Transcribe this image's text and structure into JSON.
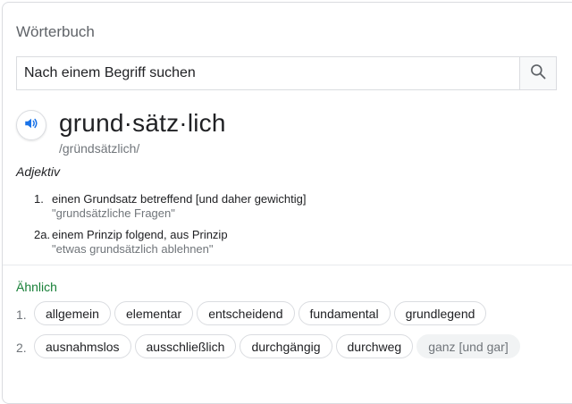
{
  "header": {
    "title": "Wörterbuch"
  },
  "search": {
    "placeholder": "Nach einem Begriff suchen",
    "button_icon": "search-icon"
  },
  "entry": {
    "audio_icon": "speaker-icon",
    "headword": "grund·sätz·lich",
    "phonetic": "/gründsätzlich/",
    "part_of_speech": "Adjektiv",
    "definitions": [
      {
        "number": "1.",
        "text": "einen Grundsatz betreffend [und daher gewichtig]",
        "example": "\"grundsätzliche Fragen\""
      },
      {
        "number": "2a.",
        "text": "einem Prinzip folgend, aus Prinzip",
        "example": "\"etwas grundsätzlich ablehnen\""
      }
    ]
  },
  "similar": {
    "label": "Ähnlich",
    "rows": [
      {
        "number": "1.",
        "chips": [
          "allgemein",
          "elementar",
          "entscheidend",
          "fundamental",
          "grundlegend"
        ]
      },
      {
        "number": "2.",
        "chips": [
          "ausnahmslos",
          "ausschließlich",
          "durchgängig",
          "durchweg",
          "ganz [und gar]"
        ],
        "muted_chips": [
          "ganz [und gar]"
        ]
      }
    ]
  },
  "colors": {
    "accent_blue": "#1a73e8",
    "similar_green": "#188038",
    "border": "#dadce0",
    "muted_text": "#70757a"
  }
}
